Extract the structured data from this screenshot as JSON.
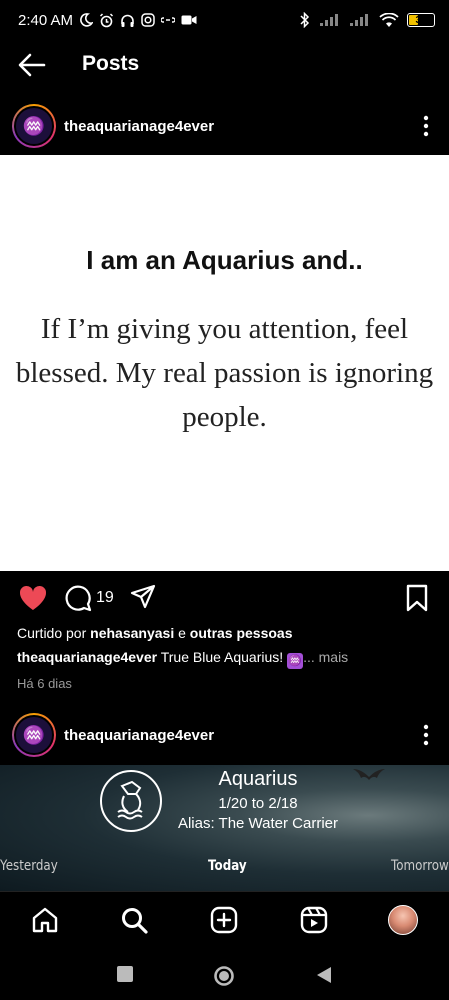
{
  "status_bar": {
    "time": "2:40 AM",
    "battery_level": "37"
  },
  "header": {
    "title": "Posts"
  },
  "post1": {
    "username": "theaquarianage4ever",
    "headline": "I am an Aquarius and..",
    "quote": "If I’m giving you attention, feel blessed. My real passion is ignoring people.",
    "comment_count": "19",
    "likes_prefix": "Curtido por",
    "likes_user": "nehasanyasi",
    "likes_connector": "e",
    "likes_suffix": "outras pessoas",
    "caption_user": "theaquarianage4ever",
    "caption_text": "True Blue Aquarius!",
    "caption_sign": "♒",
    "caption_more": "... mais",
    "timestamp": "Há 6 dias",
    "liked": true,
    "like_color": "#ed4956"
  },
  "post2": {
    "username": "theaquarianage4ever",
    "title": "Aquarius",
    "dates": "1/20 to 2/18",
    "alias": "Alias: The Water Carrier",
    "tabs": {
      "yesterday": "Yesterday",
      "today": "Today",
      "tomorrow": "Tomorrow"
    }
  },
  "icons": {
    "back": "arrow-left-icon",
    "more": "more-vertical-icon",
    "heart": "heart-icon",
    "comment": "comment-icon",
    "share": "send-icon",
    "save": "bookmark-icon",
    "nav": [
      "home-icon",
      "search-icon",
      "create-icon",
      "reels-icon",
      "profile-avatar"
    ]
  }
}
